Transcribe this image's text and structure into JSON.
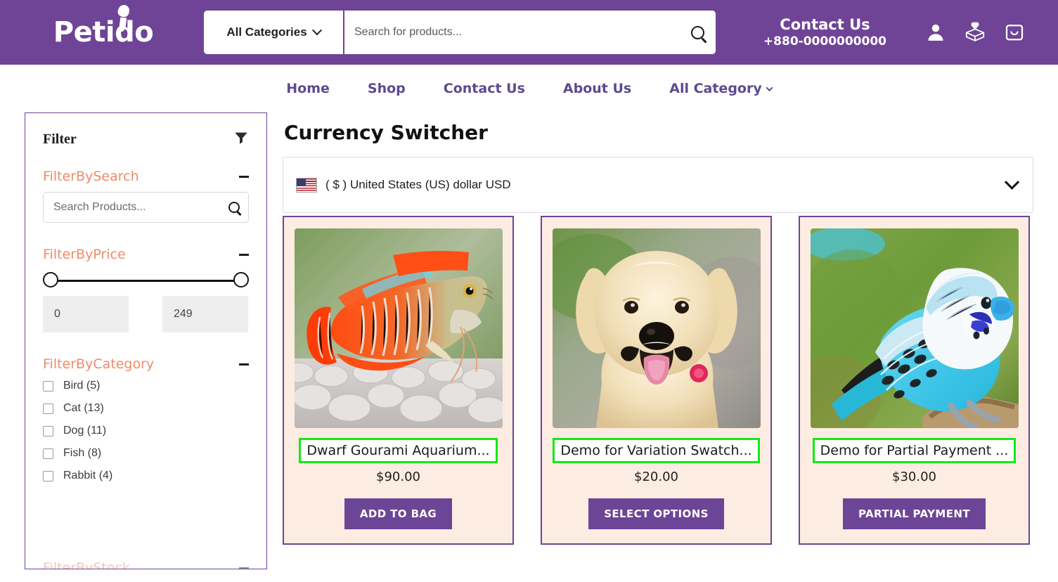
{
  "brand": {
    "name": "Petido"
  },
  "header": {
    "category_select": "All Categories",
    "search_placeholder": "Search for products...",
    "search_value": "",
    "contact_label": "Contact Us",
    "contact_phone": "+880-0000000000",
    "icons": [
      "user-icon",
      "wishlist-box-icon",
      "shopping-bag-icon"
    ]
  },
  "nav": {
    "items": [
      {
        "label": "Home"
      },
      {
        "label": "Shop"
      },
      {
        "label": "Contact Us"
      },
      {
        "label": "About Us"
      },
      {
        "label": "All Category",
        "has_chevron": true
      }
    ]
  },
  "sidebar": {
    "title": "Filter",
    "icon": "funnel-filter-icon",
    "search_section": {
      "title": "FilterBySearch",
      "toggle": "minus",
      "placeholder": "Search Products...",
      "value": ""
    },
    "price_section": {
      "title": "FilterByPrice",
      "toggle": "minus",
      "min_value": "0",
      "max_value": "249"
    },
    "category_section": {
      "title": "FilterByCategory",
      "toggle": "minus",
      "items": [
        {
          "label": "Bird (5)",
          "checked": false
        },
        {
          "label": "Cat (13)",
          "checked": false
        },
        {
          "label": "Dog (11)",
          "checked": false
        },
        {
          "label": "Fish (8)",
          "checked": false
        },
        {
          "label": "Rabbit (4)",
          "checked": false
        }
      ]
    },
    "cut_section": {
      "title": "FilterByStock",
      "toggle": "minus"
    }
  },
  "main": {
    "page_title": "Currency Switcher",
    "currency": {
      "flag": "us-flag-icon",
      "label": "( $ ) United States (US) dollar USD",
      "chevron": "chevron-down-icon"
    },
    "products": [
      {
        "title": "Dwarf Gourami Aquarium...",
        "price": "$90.00",
        "cta": "ADD TO BAG",
        "image": "dwarf-gourami-fish-photo"
      },
      {
        "title": "Demo for Variation Swatch...",
        "price": "$20.00",
        "cta": "SELECT OPTIONS",
        "image": "golden-retriever-dog-photo"
      },
      {
        "title": "Demo for Partial Payment ...",
        "price": "$30.00",
        "cta": "PARTIAL PAYMENT",
        "image": "blue-budgerigar-bird-photo"
      }
    ]
  },
  "colors": {
    "brand_purple": "#6f4496",
    "button_purple": "#6d4596",
    "card_bg": "#fdece2",
    "accent_orange": "#f08b6a",
    "highlight_green": "#16e816",
    "nav_text": "#5d4a8e"
  }
}
